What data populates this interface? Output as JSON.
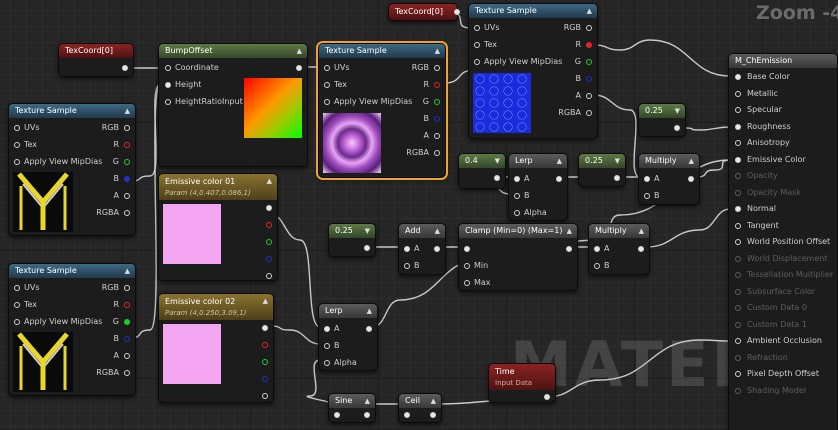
{
  "viewport": {
    "zoom_label": "Zoom -4",
    "watermark": "MATERIAL"
  },
  "nodes": {
    "texcoord_a": {
      "title": "TexCoord[0]"
    },
    "texcoord_b": {
      "title": "TexCoord[0]"
    },
    "bumpoffset": {
      "title": "BumpOffset",
      "pins": [
        "Coordinate",
        "Height",
        "HeightRatioInput"
      ]
    },
    "texsample_top": {
      "title": "Texture Sample",
      "inputs": [
        "UVs",
        "Tex",
        "Apply View MipDias"
      ],
      "outputs": [
        "RGB",
        "R",
        "G",
        "B",
        "A",
        "RGBA"
      ]
    },
    "texsample_center": {
      "title": "Texture Sample",
      "inputs": [
        "UVs",
        "Tex",
        "Apply View MipDias"
      ],
      "outputs": [
        "RGB",
        "R",
        "G",
        "B",
        "A",
        "RGBA"
      ]
    },
    "texsample_left1": {
      "title": "Texture Sample",
      "inputs": [
        "UVs",
        "Tex",
        "Apply View MipDias"
      ],
      "outputs": [
        "RGB",
        "R",
        "G",
        "B",
        "A",
        "RGBA"
      ]
    },
    "texsample_left2": {
      "title": "Texture Sample",
      "inputs": [
        "UVs",
        "Tex",
        "Apply View MipDias"
      ],
      "outputs": [
        "RGB",
        "R",
        "G",
        "B",
        "A",
        "RGBA"
      ]
    },
    "emissive01": {
      "title": "Emissive color 01",
      "subtitle": "Param (4,0.407,0.086,1)"
    },
    "emissive02": {
      "title": "Emissive color 02",
      "subtitle": "Param (4,0.250,3.09,1)"
    },
    "const_025_a": {
      "value": "0.25"
    },
    "const_04": {
      "value": "0.4"
    },
    "const_025_b": {
      "value": "0.25"
    },
    "const_025_c": {
      "value": "0.25"
    },
    "lerp_top": {
      "title": "Lerp",
      "pins": [
        "A",
        "B",
        "Alpha"
      ]
    },
    "lerp_bottom": {
      "title": "Lerp",
      "pins": [
        "A",
        "B",
        "Alpha"
      ]
    },
    "multiply_top": {
      "title": "Multiply",
      "pins": [
        "A",
        "B"
      ]
    },
    "multiply_bottom": {
      "title": "Multiply",
      "pins": [
        "A",
        "B"
      ]
    },
    "add": {
      "title": "Add",
      "pins": [
        "A",
        "B"
      ]
    },
    "clamp": {
      "title": "Clamp (Min=0) (Max=1)",
      "pins": [
        "",
        "Min",
        "Max"
      ]
    },
    "time": {
      "title": "Time",
      "subtitle": "Input Data"
    },
    "sine": {
      "title": "Sine"
    },
    "ceil": {
      "title": "Ceil"
    },
    "material": {
      "title": "M_ChEmission",
      "pins": [
        "Base Color",
        "Metallic",
        "Specular",
        "Roughness",
        "Anisotropy",
        "Emissive Color",
        "Opacity",
        "Opacity Mask",
        "Normal",
        "Tangent",
        "World Position Offset",
        "World Displacement",
        "Tessellation Multiplier",
        "Subsurface Color",
        "Custom Data 0",
        "Custom Data 1",
        "Ambient Occlusion",
        "Refraction",
        "Pixel Depth Offset",
        "Shading Model"
      ],
      "dim_pins": [
        6,
        7,
        11,
        12,
        13,
        14,
        15,
        17,
        19
      ]
    }
  },
  "colors": {
    "accent_selected": "#f0a330",
    "emissive_swatch": "#f5a6f3",
    "wire": "#e6e6e6"
  }
}
